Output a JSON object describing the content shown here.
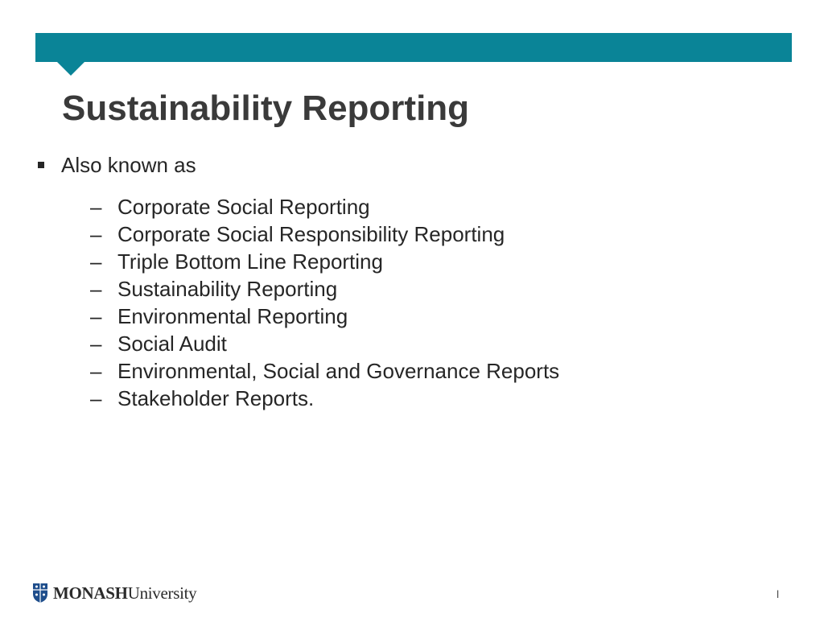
{
  "slide": {
    "title": "Sustainability Reporting",
    "bullet": "Also known as",
    "dash_glyph": "–",
    "items": [
      "Corporate Social Reporting",
      "Corporate Social Responsibility Reporting",
      "Triple Bottom Line Reporting",
      "Sustainability Reporting",
      "Environmental Reporting",
      "Social Audit",
      "Environmental, Social and Governance Reports",
      "Stakeholder Reports."
    ]
  },
  "footer": {
    "logo_bold": "MONASH",
    "logo_regular": "University",
    "page_number": "l"
  },
  "colors": {
    "band": "#0a8497",
    "title": "#3a3a3a",
    "text": "#262626"
  },
  "icons": {
    "logo": "monash-crest-icon"
  }
}
